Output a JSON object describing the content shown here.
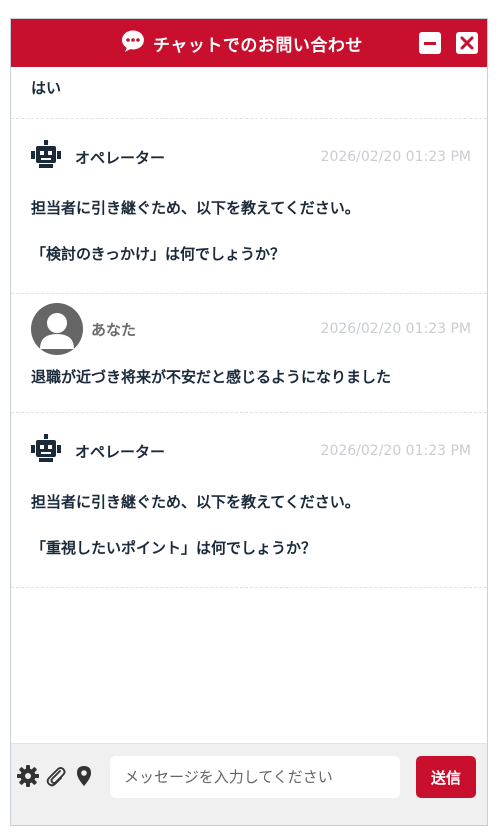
{
  "header": {
    "title": "チャットでのお問い合わせ",
    "icons": [
      "chat-bubble-icon",
      "minimize-icon",
      "close-icon"
    ],
    "color": "#c8102e"
  },
  "messages": {
    "partial_text": "はい",
    "items": [
      {
        "sender": "オペレーター",
        "time": "2026/02/20 01:23 PM",
        "lines": [
          "担当者に引き継ぐため、以下を教えてください。",
          "「検討のきっかけ」は何でしょうか？"
        ]
      },
      {
        "sender": "あなた",
        "time": "2026/02/20 01:23 PM",
        "text": "退職が近づき将来が不安だと感じるようになりました"
      },
      {
        "sender": "オペレーター",
        "time": "2026/02/20 01:23 PM",
        "lines": [
          "担当者に引き継ぐため、以下を教えてください。",
          "「重視したいポイント」は何でしょうか？"
        ]
      }
    ]
  },
  "footer": {
    "tools": [
      "gear-icon",
      "paperclip-icon",
      "location-pin-icon"
    ],
    "input_placeholder": "メッセージを入力してください",
    "send_label": "送信"
  }
}
